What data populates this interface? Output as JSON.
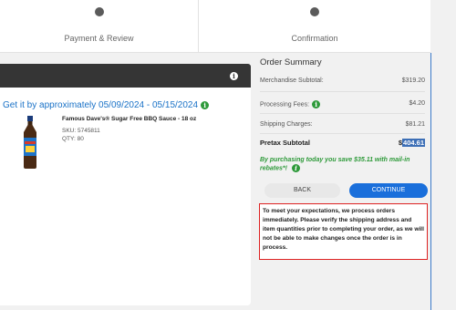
{
  "stepper": {
    "steps": [
      {
        "label": "Payment & Review"
      },
      {
        "label": "Confirmation"
      }
    ]
  },
  "delivery": {
    "text": "Get it by approximately 05/09/2024 - 05/15/2024",
    "info_icon": "info-icon"
  },
  "product": {
    "name": "Famous Dave's® Sugar Free BBQ Sauce - 18 oz",
    "sku": "SKU: 5745811",
    "qty": "QTY: 80"
  },
  "summary": {
    "title": "Order Summary",
    "rows": [
      {
        "label": "Merchandise Subtotal:",
        "value": "$319.20"
      },
      {
        "label": "Processing Fees:",
        "value": "$4.20"
      },
      {
        "label": "Shipping Charges:",
        "value": "$81.21"
      }
    ],
    "pretax_label": "Pretax Subtotal",
    "pretax_currency": "$",
    "pretax_amount": "404.61",
    "rebate": "By purchasing today you save $35.11 with mail-in rebates*!",
    "back_label": "BACK",
    "continue_label": "CONTINUE",
    "notice": "To meet your expectations, we process orders immediately. Please verify the shipping address and item quantities prior to completing your order, as we will not be able to make changes once the order is in process."
  },
  "colors": {
    "accent_blue": "#1a6fdb",
    "link_blue": "#1a72c7",
    "rebate_green": "#2e9a3a",
    "notice_border": "#dd2222",
    "header_dark": "#353535"
  }
}
